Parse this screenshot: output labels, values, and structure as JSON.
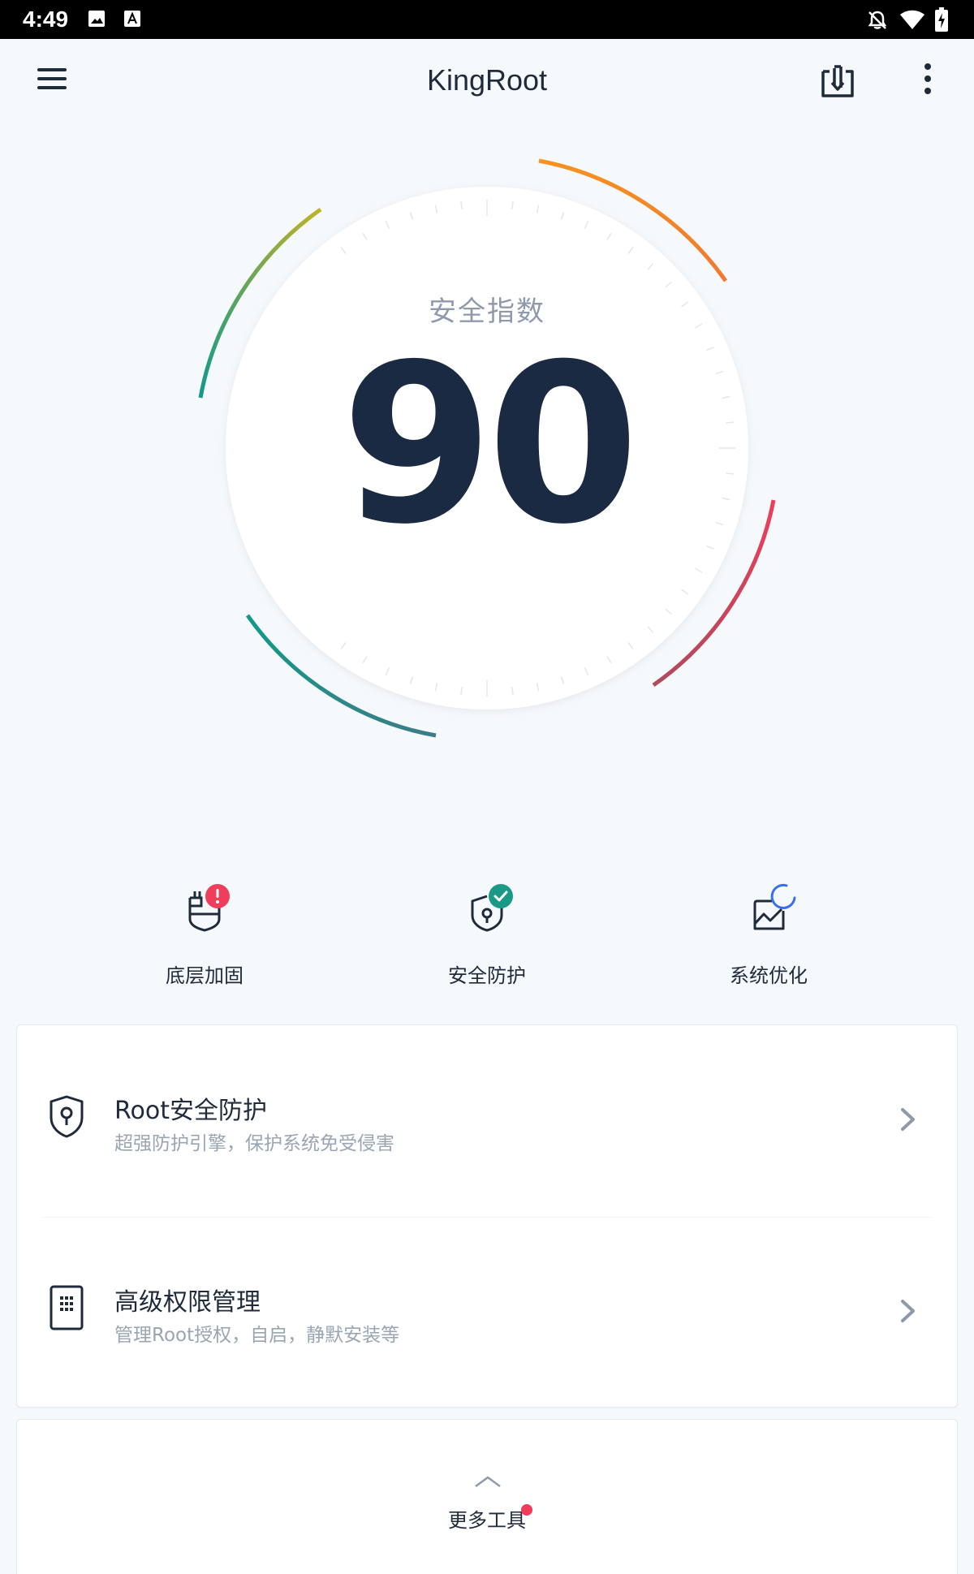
{
  "status_bar": {
    "time": "4:49",
    "icons": [
      "image-icon",
      "text-a-icon",
      "notifications-off-icon",
      "wifi-icon",
      "battery-charging-icon"
    ]
  },
  "app_bar": {
    "title": "KingRoot",
    "icons": [
      "menu-icon",
      "download-box-icon",
      "more-vert-icon"
    ]
  },
  "security_gauge": {
    "label": "安全指数",
    "score": "90",
    "colors": {
      "orange": "#f7931e",
      "red": "#e8425a",
      "teal": "#179a8a",
      "olive": "#b8b32a",
      "dark": "#1a2a42"
    }
  },
  "quick_actions": [
    {
      "label": "底层加固",
      "icon": "shield-plug-icon",
      "badge": "alert",
      "badge_color": "#ef3d5c"
    },
    {
      "label": "安全防护",
      "icon": "shield-lock-icon",
      "badge": "check",
      "badge_color": "#1a9a86"
    },
    {
      "label": "系统优化",
      "icon": "chart-refresh-icon",
      "badge": "loading",
      "badge_color": "#3a6ff0"
    }
  ],
  "feature_list": [
    {
      "title": "Root安全防护",
      "subtitle": "超强防护引擎，保护系统免受侵害",
      "icon": "shield-keyhole-icon"
    },
    {
      "title": "高级权限管理",
      "subtitle": "管理Root授权，自启，静默安装等",
      "icon": "keypad-icon"
    }
  ],
  "more_tools": {
    "label": "更多工具",
    "badge_color": "#f03c5a"
  }
}
